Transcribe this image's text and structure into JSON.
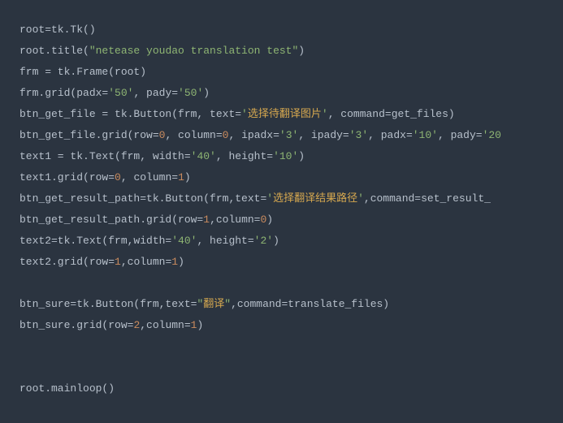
{
  "lines": {
    "l1": {
      "a": "root=tk.Tk()"
    },
    "l2": {
      "a": "root.title(",
      "b": "\"netease youdao translation test\"",
      "c": ")"
    },
    "l3": {
      "a": "frm = tk.Frame(root)"
    },
    "l4": {
      "a": "frm.grid(padx=",
      "b": "'50'",
      "c": ", pady=",
      "d": "'50'",
      "e": ")"
    },
    "l5": {
      "a": "btn_get_file = tk.Button(frm, text=",
      "b": "'",
      "c": "选择待翻译图片",
      "d": "'",
      "e": ", command=get_files)"
    },
    "l6": {
      "a": "btn_get_file.grid(row=",
      "b": "0",
      "c": ", column=",
      "d": "0",
      "e": ", ipadx=",
      "f": "'3'",
      "g": ", ipady=",
      "h": "'3'",
      "i": ", padx=",
      "j": "'10'",
      "k": ", pady=",
      "l": "'20"
    },
    "l7": {
      "a": "text1 = tk.Text(frm, width=",
      "b": "'40'",
      "c": ", height=",
      "d": "'10'",
      "e": ")"
    },
    "l8": {
      "a": "text1.grid(row=",
      "b": "0",
      "c": ", column=",
      "d": "1",
      "e": ")"
    },
    "l9": {
      "a": "btn_get_result_path=tk.Button(frm,text=",
      "b": "'",
      "c": "选择翻译结果路径",
      "d": "'",
      "e": ",command=set_result_"
    },
    "l10": {
      "a": "btn_get_result_path.grid(row=",
      "b": "1",
      "c": ",column=",
      "d": "0",
      "e": ")"
    },
    "l11": {
      "a": "text2=tk.Text(frm,width=",
      "b": "'40'",
      "c": ", height=",
      "d": "'2'",
      "e": ")"
    },
    "l12": {
      "a": "text2.grid(row=",
      "b": "1",
      "c": ",column=",
      "d": "1",
      "e": ")"
    },
    "l13": {
      "a": "btn_sure=tk.Button(frm,text=",
      "b": "\"",
      "c": "翻译",
      "d": "\"",
      "e": ",command=translate_files)"
    },
    "l14": {
      "a": "btn_sure.grid(row=",
      "b": "2",
      "c": ",column=",
      "d": "1",
      "e": ")"
    },
    "l15": {
      "a": "root.mainloop()"
    }
  }
}
